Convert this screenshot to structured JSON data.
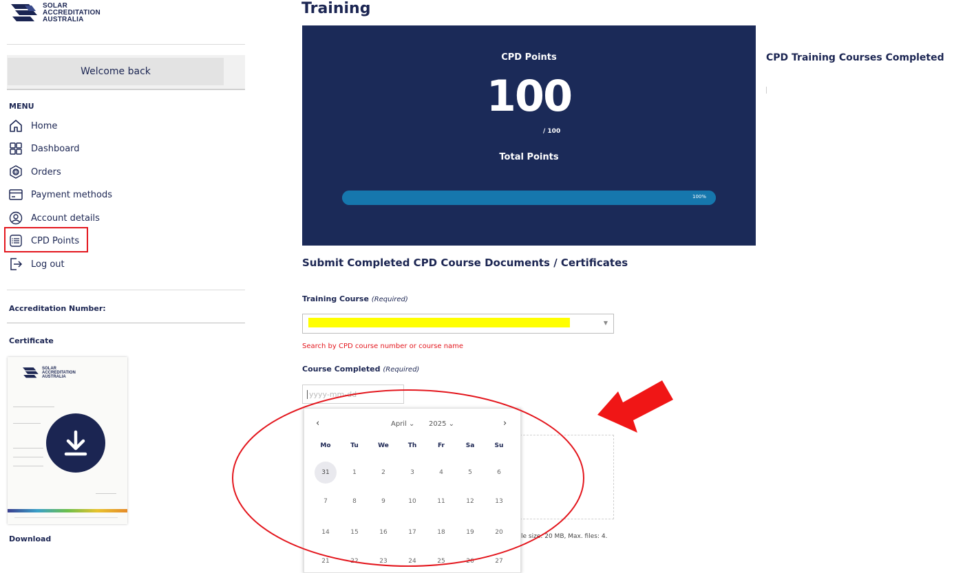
{
  "brand": {
    "logo_lines": [
      "SOLAR",
      "ACCREDITATION",
      "AUSTRALIA"
    ]
  },
  "sidebar": {
    "welcome": "Welcome back",
    "menu_label": "MENU",
    "items": [
      {
        "label": "Home",
        "icon": "home-icon"
      },
      {
        "label": "Dashboard",
        "icon": "dashboard-icon"
      },
      {
        "label": "Orders",
        "icon": "orders-icon"
      },
      {
        "label": "Payment methods",
        "icon": "payment-icon"
      },
      {
        "label": "Account details",
        "icon": "account-icon"
      },
      {
        "label": "CPD Points",
        "icon": "list-icon"
      },
      {
        "label": "Log out",
        "icon": "logout-icon"
      }
    ],
    "accreditation_label": "Accreditation Number:",
    "certificate_label": "Certificate",
    "download_label": "Download"
  },
  "main": {
    "page_title": "Training",
    "stats": {
      "heading": "CPD Points",
      "value": "100",
      "max": "/ 100",
      "subheading": "Total Points",
      "progress_percent": 100,
      "progress_label": "100%"
    },
    "right_heading": "CPD Training Courses Completed",
    "form": {
      "section_heading": "Submit Completed CPD Course Documents / Certificates",
      "training_course_label": "Training Course",
      "required_note": "(Required)",
      "course_hint": "Search by CPD course number or course name",
      "course_completed_label": "Course Completed",
      "date_placeholder": "yyyy-mm-dd",
      "file_hint": "le size: 20 MB, Max. files: 4."
    },
    "calendar": {
      "month": "April",
      "year": "2025",
      "weekdays": [
        "Mo",
        "Tu",
        "We",
        "Th",
        "Fr",
        "Sa",
        "Su"
      ],
      "rows": [
        [
          "31",
          "1",
          "2",
          "3",
          "4",
          "5",
          "6"
        ],
        [
          "7",
          "8",
          "9",
          "10",
          "11",
          "12",
          "13"
        ],
        [
          "14",
          "15",
          "16",
          "17",
          "18",
          "19",
          "20"
        ],
        [
          "21",
          "22",
          "23",
          "24",
          "25",
          "26",
          "27"
        ]
      ]
    }
  },
  "colors": {
    "navy": "#1b2a58",
    "progress": "#1677ad",
    "annotation_red": "#e3151c",
    "redaction": "#ffff00"
  }
}
